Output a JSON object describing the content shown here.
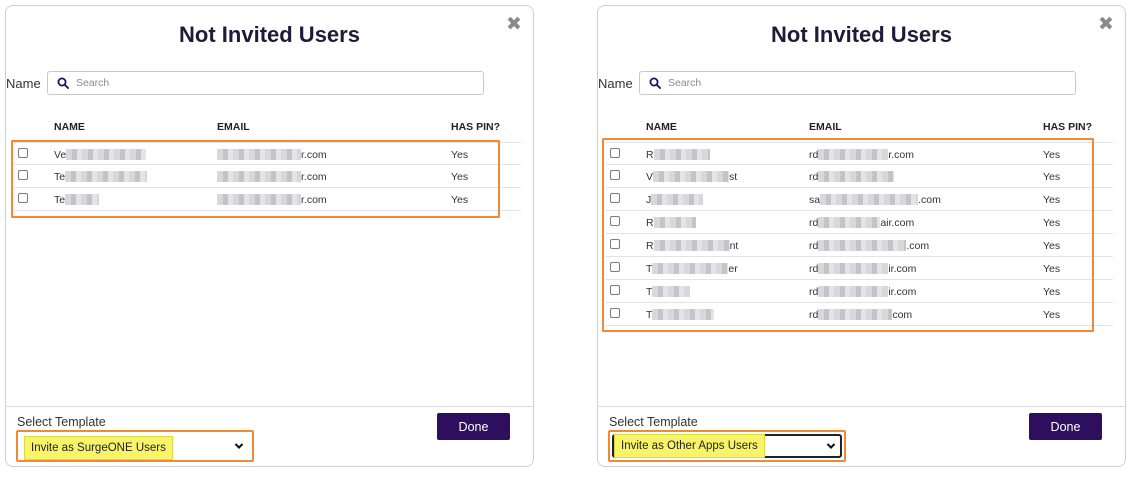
{
  "accent_color": "#2e0f5f",
  "highlight_color": "#f08a34",
  "left": {
    "title": "Not Invited Users",
    "close_glyph": "✖",
    "name_label": "Name",
    "search_placeholder": "Search",
    "columns": {
      "name": "NAME",
      "email": "EMAIL",
      "has_pin": "HAS PIN?"
    },
    "rows": [
      {
        "name_prefix": "Ve",
        "name_suffix": "",
        "email_prefix": "",
        "email_suffix": "r.com",
        "has_pin": "Yes"
      },
      {
        "name_prefix": "Te",
        "name_suffix": "",
        "email_prefix": "",
        "email_suffix": "r.com",
        "has_pin": "Yes"
      },
      {
        "name_prefix": "Te",
        "name_suffix": "",
        "email_prefix": "",
        "email_suffix": "r.com",
        "has_pin": "Yes"
      }
    ],
    "select_label": "Select Template",
    "select_value": "Invite as SurgeONE Users",
    "done_label": "Done"
  },
  "right": {
    "title": "Not Invited Users",
    "close_glyph": "✖",
    "name_label": "Name",
    "search_placeholder": "Search",
    "columns": {
      "name": "NAME",
      "email": "EMAIL",
      "has_pin": "HAS PIN?"
    },
    "rows": [
      {
        "name_prefix": "R",
        "name_suffix": "",
        "email_prefix": "rd",
        "email_suffix": "r.com",
        "has_pin": "Yes"
      },
      {
        "name_prefix": "V",
        "name_suffix": "st",
        "email_prefix": "rd",
        "email_suffix": "",
        "has_pin": "Yes"
      },
      {
        "name_prefix": "J",
        "name_suffix": "",
        "email_prefix": "sa",
        "email_suffix": ".com",
        "has_pin": "Yes"
      },
      {
        "name_prefix": "R",
        "name_suffix": "",
        "email_prefix": "rd",
        "email_suffix": "air.com",
        "has_pin": "Yes"
      },
      {
        "name_prefix": "R",
        "name_suffix": "nt",
        "email_prefix": "rd",
        "email_suffix": ".com",
        "has_pin": "Yes"
      },
      {
        "name_prefix": "T",
        "name_suffix": "er",
        "email_prefix": "rd",
        "email_suffix": "ir.com",
        "has_pin": "Yes"
      },
      {
        "name_prefix": "T",
        "name_suffix": "",
        "email_prefix": "rd",
        "email_suffix": "ir.com",
        "has_pin": "Yes"
      },
      {
        "name_prefix": "T",
        "name_suffix": "",
        "email_prefix": "rd",
        "email_suffix": "com",
        "has_pin": "Yes"
      }
    ],
    "select_label": "Select Template",
    "select_value": "Invite as Other Apps Users",
    "done_label": "Done"
  }
}
